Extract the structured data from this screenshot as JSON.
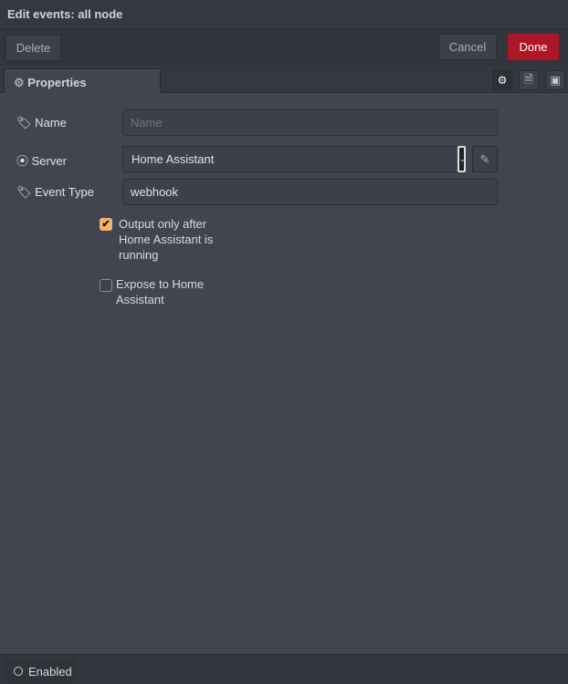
{
  "title": "Edit events: all node",
  "toolbar": {
    "delete": "Delete",
    "cancel": "Cancel",
    "done": "Done"
  },
  "tabs": {
    "properties": "Properties"
  },
  "form": {
    "name_label": "Name",
    "name_placeholder": "Name",
    "name_value": "",
    "server_label": "Server",
    "server_value": "Home Assistant",
    "event_type_label": "Event Type",
    "event_type_value": "webhook",
    "output_only_label": "Output only after Home Assistant is running",
    "output_only_checked": true,
    "expose_label": "Expose to Home Assistant",
    "expose_checked": false
  },
  "footer": {
    "enabled": "Enabled"
  },
  "colors": {
    "done": "#ad1625",
    "checkbox": "#f2b36b"
  }
}
